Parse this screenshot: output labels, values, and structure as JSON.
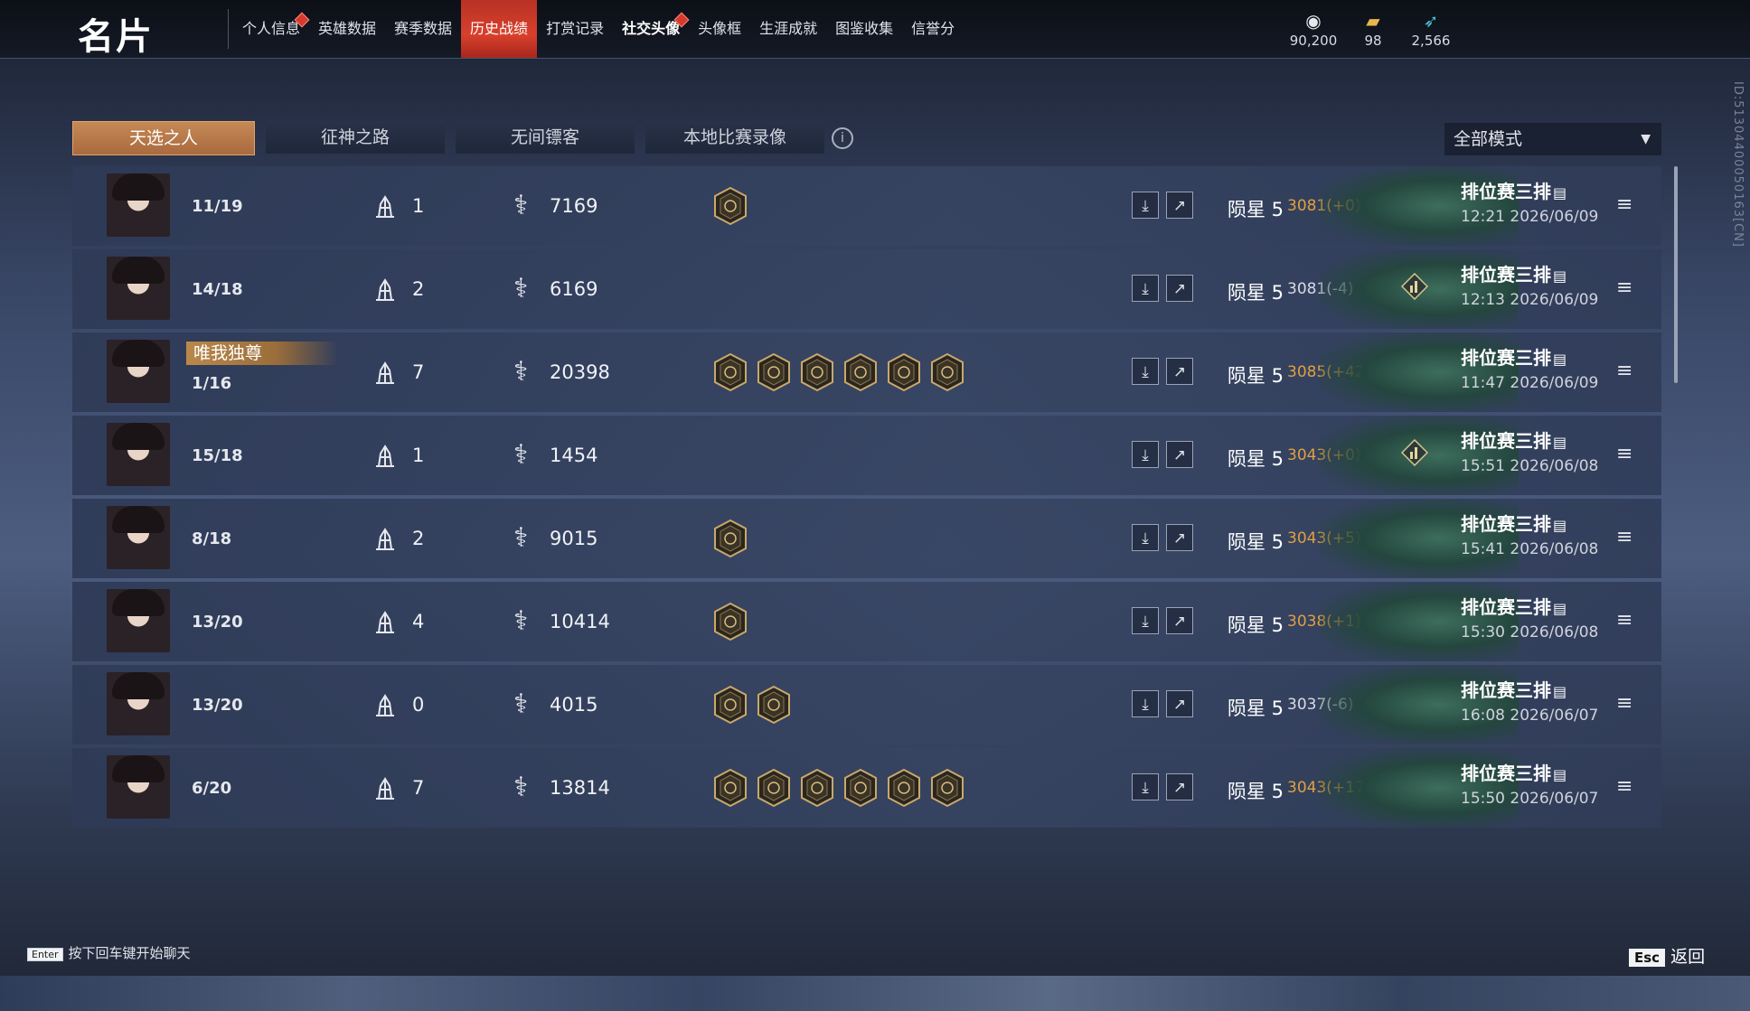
{
  "header": {
    "title": "名片",
    "nav": [
      {
        "label": "个人信息",
        "dot": true
      },
      {
        "label": "英雄数据"
      },
      {
        "label": "赛季数据"
      },
      {
        "label": "历史战绩",
        "active": true
      },
      {
        "label": "打赏记录"
      },
      {
        "label": "社交头像",
        "dot": true,
        "bold": true
      },
      {
        "label": "头像框"
      },
      {
        "label": "生涯成就"
      },
      {
        "label": "图鉴收集"
      },
      {
        "label": "信誉分"
      }
    ],
    "currencies": [
      {
        "icon": "coin-icon",
        "value": "90,200"
      },
      {
        "icon": "ticket-icon",
        "value": "98"
      },
      {
        "icon": "feather-icon",
        "value": "2,566"
      }
    ]
  },
  "player_id": "ID:513044000501​63[CN]",
  "tabs": [
    "天选之人",
    "征神之路",
    "无间镖客",
    "本地比赛录像"
  ],
  "mode_filter": "全部模式",
  "matches": [
    {
      "kda": "11/19",
      "place": "1",
      "damage": "7169",
      "badges": [
        "emblem-1"
      ],
      "rank": "陨星 5",
      "score": "3081(+0)",
      "score_color": "#e0a040",
      "stat_icon": false,
      "mode": "排位赛三排",
      "time": "12:21  2026/06/09"
    },
    {
      "kda": "14/18",
      "place": "2",
      "damage": "6169",
      "badges": [],
      "rank": "陨星 5",
      "score": "3081(-4)",
      "score_color": "#d8dbe2",
      "stat_icon": true,
      "mode": "排位赛三排",
      "time": "12:13  2026/06/09"
    },
    {
      "title": "唯我独尊",
      "kda": "1/16",
      "place": "7",
      "damage": "20398",
      "badges": [
        "emblem-2",
        "emblem-3",
        "emblem-4",
        "emblem-5",
        "emblem-6",
        "emblem-1"
      ],
      "rank": "陨星 5",
      "score": "3085(+42)",
      "score_color": "#e0a040",
      "stat_icon": false,
      "mode": "排位赛三排",
      "time": "11:47  2026/06/09"
    },
    {
      "kda": "15/18",
      "place": "1",
      "damage": "1454",
      "badges": [],
      "rank": "陨星 5",
      "score": "3043(+0)",
      "score_color": "#e0a040",
      "stat_icon": true,
      "mode": "排位赛三排",
      "time": "15:51  2026/06/08"
    },
    {
      "kda": "8/18",
      "place": "2",
      "damage": "9015",
      "badges": [
        "emblem-7"
      ],
      "rank": "陨星 5",
      "score": "3043(+5)",
      "score_color": "#e0a040",
      "stat_icon": false,
      "mode": "排位赛三排",
      "time": "15:41  2026/06/08"
    },
    {
      "kda": "13/20",
      "place": "4",
      "damage": "10414",
      "badges": [
        "emblem-8"
      ],
      "rank": "陨星 5",
      "score": "3038(+1)",
      "score_color": "#e0a040",
      "stat_icon": false,
      "mode": "排位赛三排",
      "time": "15:30  2026/06/08"
    },
    {
      "kda": "13/20",
      "place": "0",
      "damage": "4015",
      "badges": [
        "emblem-9",
        "emblem-10"
      ],
      "rank": "陨星 5",
      "score": "3037(-6)",
      "score_color": "#d8dbe2",
      "stat_icon": false,
      "mode": "排位赛三排",
      "time": "16:08  2026/06/07"
    },
    {
      "kda": "6/20",
      "place": "7",
      "damage": "13814",
      "badges": [
        "emblem-2",
        "emblem-3",
        "emblem-4",
        "emblem-5",
        "emblem-6",
        "emblem-7"
      ],
      "rank": "陨星 5",
      "score": "3043(+17)",
      "score_color": "#e0a040",
      "stat_icon": false,
      "mode": "排位赛三排",
      "time": "15:50  2026/06/07"
    }
  ],
  "footer": {
    "enter_key": "Enter",
    "hint": "按下回车键开始聊天",
    "esc_key": "Esc",
    "back": "返回"
  }
}
